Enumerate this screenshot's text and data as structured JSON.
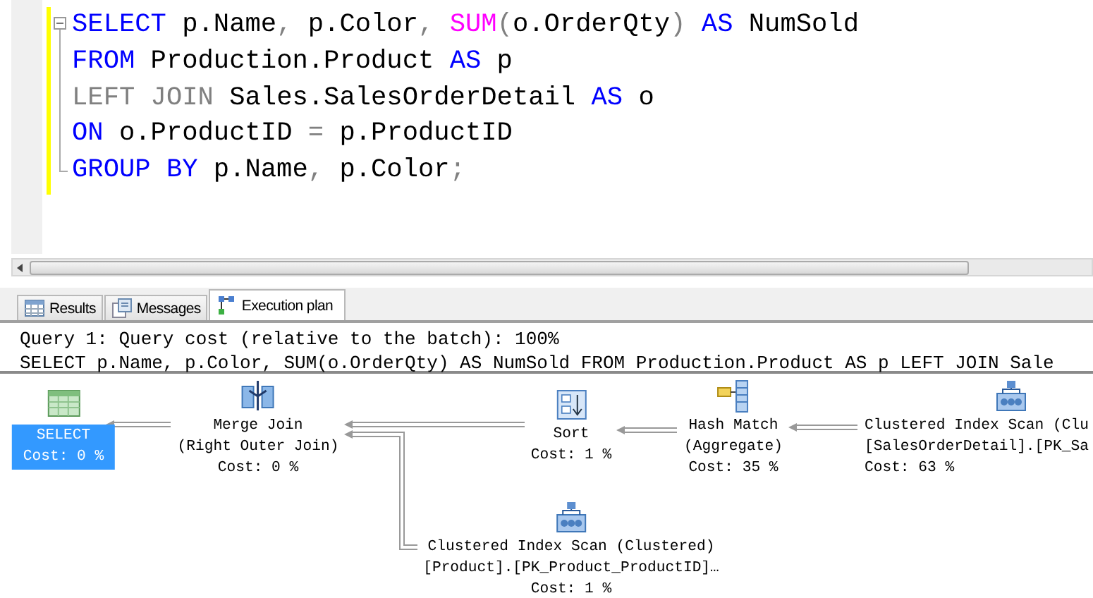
{
  "editor": {
    "lines": [
      [
        {
          "text": "SELECT",
          "kind": "keyword"
        },
        {
          "text": " p.Name",
          "kind": "plain"
        },
        {
          "text": ",",
          "kind": "operator"
        },
        {
          "text": " p.Color",
          "kind": "plain"
        },
        {
          "text": ", ",
          "kind": "operator"
        },
        {
          "text": "SUM",
          "kind": "function"
        },
        {
          "text": "(",
          "kind": "operator"
        },
        {
          "text": "o.OrderQty",
          "kind": "plain"
        },
        {
          "text": ") ",
          "kind": "operator"
        },
        {
          "text": "AS",
          "kind": "keyword"
        },
        {
          "text": " NumSold",
          "kind": "plain"
        }
      ],
      [
        {
          "text": "FROM",
          "kind": "keyword"
        },
        {
          "text": " Production.Product ",
          "kind": "plain"
        },
        {
          "text": "AS",
          "kind": "keyword"
        },
        {
          "text": " p",
          "kind": "plain"
        }
      ],
      [
        {
          "text": "LEFT JOIN",
          "kind": "operator"
        },
        {
          "text": " Sales.SalesOrderDetail ",
          "kind": "plain"
        },
        {
          "text": "AS",
          "kind": "keyword"
        },
        {
          "text": " o",
          "kind": "plain"
        }
      ],
      [
        {
          "text": "ON",
          "kind": "keyword"
        },
        {
          "text": " o.ProductID ",
          "kind": "plain"
        },
        {
          "text": "=",
          "kind": "operator"
        },
        {
          "text": " p.ProductID",
          "kind": "plain"
        }
      ],
      [
        {
          "text": "GROUP BY",
          "kind": "keyword"
        },
        {
          "text": " p.Name",
          "kind": "plain"
        },
        {
          "text": ",",
          "kind": "operator"
        },
        {
          "text": " p.Color",
          "kind": "plain"
        },
        {
          "text": ";",
          "kind": "operator"
        }
      ]
    ]
  },
  "tabs": [
    {
      "label": "Results",
      "selected": false
    },
    {
      "label": "Messages",
      "selected": false
    },
    {
      "label": "Execution plan",
      "selected": true
    }
  ],
  "plan": {
    "header": [
      "Query 1: Query cost (relative to the batch): 100%",
      "SELECT p.Name, p.Color, SUM(o.OrderQty) AS NumSold FROM Production.Product AS p LEFT JOIN Sale"
    ],
    "nodes": [
      {
        "kind": "select",
        "lines": [
          "SELECT",
          "Cost: 0 %"
        ],
        "selected": true
      },
      {
        "kind": "merge-join",
        "lines": [
          "Merge Join",
          "(Right Outer Join)",
          "Cost: 0 %"
        ],
        "selected": false
      },
      {
        "kind": "sort",
        "lines": [
          "Sort",
          "Cost: 1 %"
        ],
        "selected": false
      },
      {
        "kind": "hash-match",
        "lines": [
          "Hash Match",
          "(Aggregate)",
          "Cost: 35 %"
        ],
        "selected": false
      },
      {
        "kind": "index-scan",
        "lines": [
          "Clustered Index Scan (Clu",
          "[SalesOrderDetail].[PK_Sa",
          "Cost: 63 %"
        ],
        "selected": false
      },
      {
        "kind": "index-scan",
        "lines": [
          "Clustered Index Scan (Clustered)",
          "[Product].[PK_Product_ProductID]…",
          "Cost: 1 %"
        ],
        "selected": false
      }
    ]
  }
}
